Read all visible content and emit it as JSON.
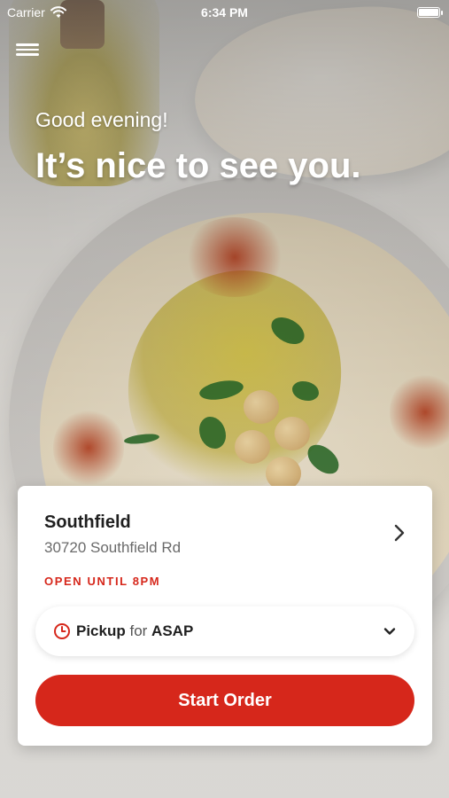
{
  "status_bar": {
    "carrier": "Carrier",
    "time": "6:34 PM",
    "icons": [
      "wifi-icon",
      "battery-icon"
    ]
  },
  "header": {
    "menu_icon": "hamburger-menu-icon",
    "greeting": "Good evening!",
    "headline": "It’s nice to see you."
  },
  "location_card": {
    "name": "Southfield",
    "address": "30720 Southfield Rd",
    "hours": "OPEN UNTIL 8PM",
    "chevron_icon": "chevron-right-icon",
    "order_type": {
      "icon": "clock-icon",
      "mode": "Pickup",
      "connector": " for ",
      "time": "ASAP",
      "dropdown_icon": "chevron-down-icon"
    },
    "cta_label": "Start Order"
  },
  "colors": {
    "accent": "#d6271b",
    "text_primary": "#1f1f1f",
    "text_secondary": "#6a6a6a",
    "card_bg": "#ffffff"
  }
}
